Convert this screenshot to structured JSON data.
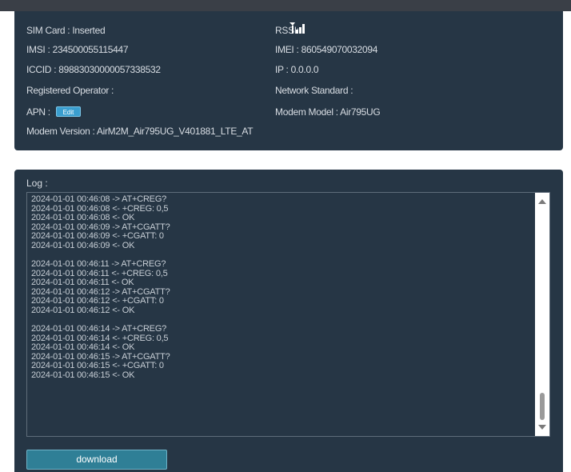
{
  "modem": {
    "sim_card": "SIM Card : Inserted",
    "rssi_label": "RSSI:",
    "imsi": "IMSI : 234500055115447",
    "imei": "IMEI : 860549070032094",
    "iccid": "ICCID : 89883030000057338532",
    "ip": "IP : 0.0.0.0",
    "registered_operator": "Registered Operator :",
    "network_standard": "Network Standard :",
    "apn_label": "APN :",
    "apn_edit_label": "Edit",
    "modem_model": "Modem Model : Air795UG",
    "modem_version": "Modem Version : AirM2M_Air795UG_V401881_LTE_AT",
    "signal_icon": "signal-strength-icon"
  },
  "log": {
    "label": "Log :",
    "groups": [
      [
        "2024-01-01 00:46:08 -> AT+CREG?",
        "2024-01-01 00:46:08 <- +CREG: 0,5",
        "2024-01-01 00:46:08 <- OK",
        "2024-01-01 00:46:09 -> AT+CGATT?",
        "2024-01-01 00:46:09 <- +CGATT: 0",
        "2024-01-01 00:46:09 <- OK"
      ],
      [
        "2024-01-01 00:46:11 -> AT+CREG?",
        "2024-01-01 00:46:11 <- +CREG: 0,5",
        "2024-01-01 00:46:11 <- OK",
        "2024-01-01 00:46:12 -> AT+CGATT?",
        "2024-01-01 00:46:12 <- +CGATT: 0",
        "2024-01-01 00:46:12 <- OK"
      ],
      [
        "2024-01-01 00:46:14 -> AT+CREG?",
        "2024-01-01 00:46:14 <- +CREG: 0,5",
        "2024-01-01 00:46:14 <- OK",
        "2024-01-01 00:46:15 -> AT+CGATT?",
        "2024-01-01 00:46:15 <- +CGATT: 0",
        "2024-01-01 00:46:15 <- OK"
      ]
    ],
    "download_label": "download"
  },
  "colors": {
    "panel_bg": "#263645",
    "text": "#d8dde3",
    "accent": "#3a9ecf",
    "download_bg": "#2f7f96"
  }
}
